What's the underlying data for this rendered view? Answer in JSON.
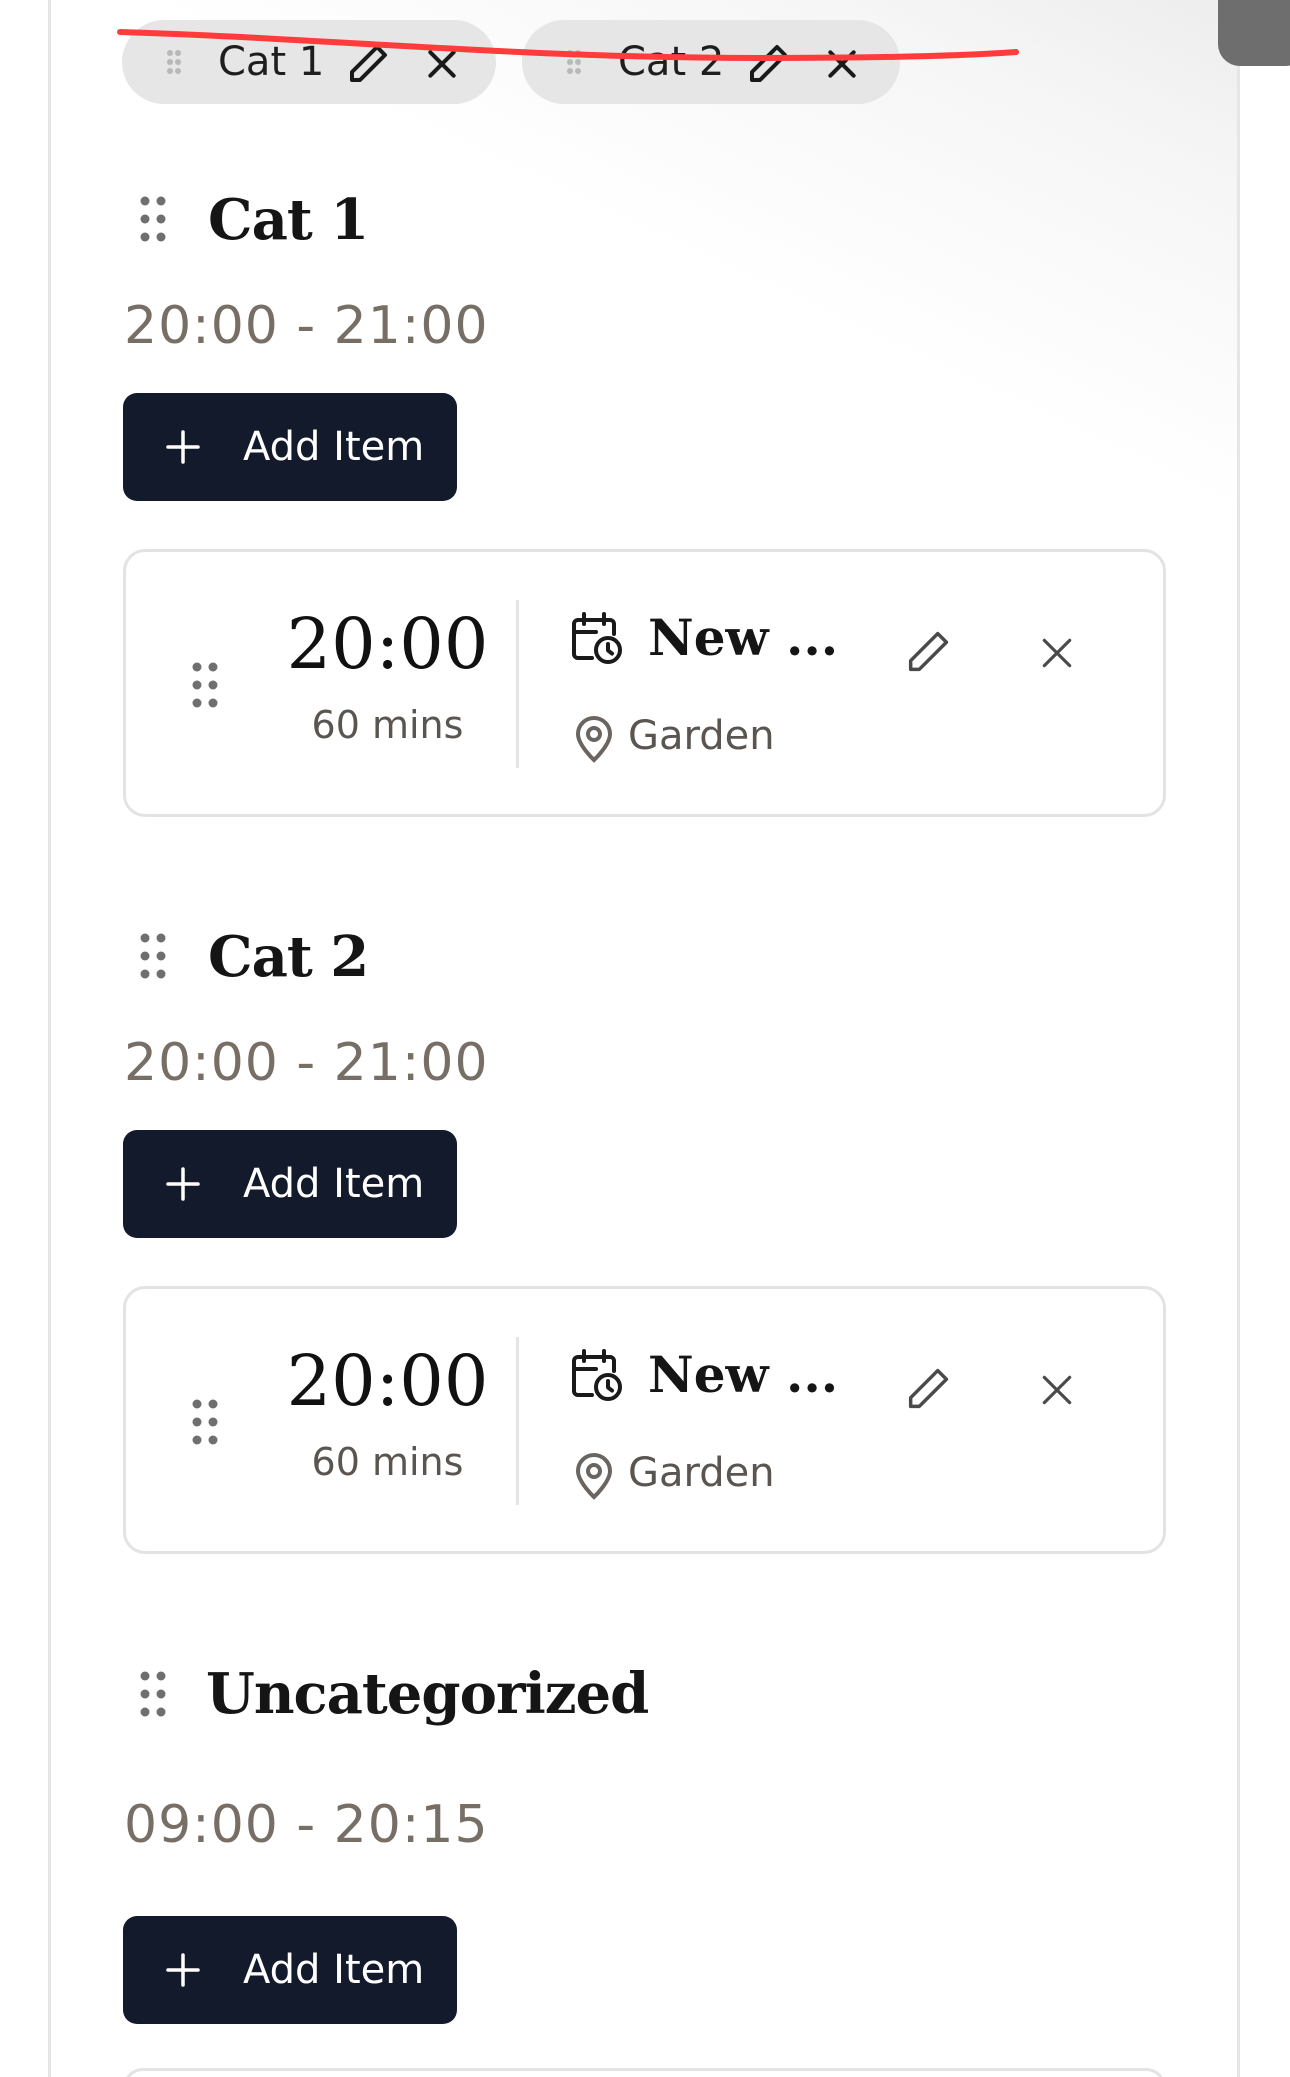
{
  "chips": [
    {
      "label": "Cat 1"
    },
    {
      "label": "Cat 2"
    }
  ],
  "sections": [
    {
      "title": "Cat 1",
      "time_range": "20:00 - 21:00",
      "add_label": "Add Item",
      "item": {
        "time": "20:00",
        "duration": "60 mins",
        "title": "New ...",
        "location": "Garden"
      }
    },
    {
      "title": "Cat 2",
      "time_range": "20:00 - 21:00",
      "add_label": "Add Item",
      "item": {
        "time": "20:00",
        "duration": "60 mins",
        "title": "New ...",
        "location": "Garden"
      }
    },
    {
      "title": "Uncategorized",
      "time_range": "09:00 - 20:15",
      "add_label": "Add Item"
    }
  ],
  "colors": {
    "button_bg": "#131a2c",
    "strike": "#ff3b3b",
    "time_text": "#776f66"
  }
}
